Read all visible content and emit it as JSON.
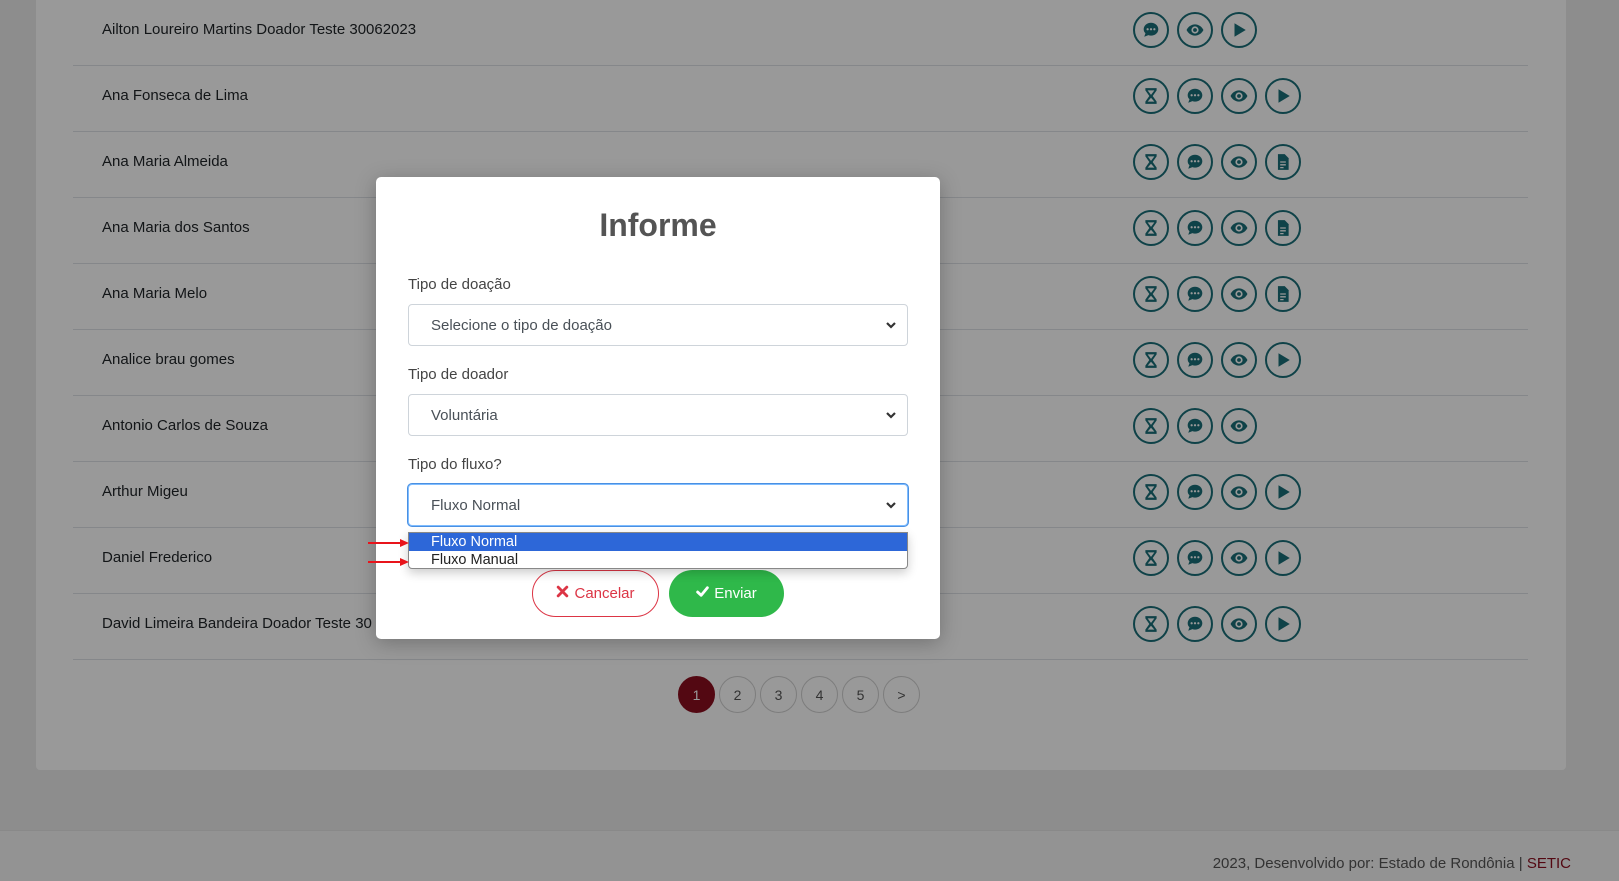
{
  "list": {
    "rows": [
      {
        "name": "Ailton Loureiro Martins Doador Teste 30062023",
        "actions": [
          "chat-icon",
          "eye-icon",
          "play-icon"
        ]
      },
      {
        "name": "Ana Fonseca de Lima",
        "actions": [
          "hourglass-icon",
          "chat-icon",
          "eye-icon",
          "play-icon"
        ]
      },
      {
        "name": "Ana Maria Almeida",
        "actions": [
          "hourglass-icon",
          "chat-icon",
          "eye-icon",
          "document-icon"
        ]
      },
      {
        "name": "Ana Maria dos Santos",
        "actions": [
          "hourglass-icon",
          "chat-icon",
          "eye-icon",
          "document-icon"
        ]
      },
      {
        "name": "Ana Maria Melo",
        "actions": [
          "hourglass-icon",
          "chat-icon",
          "eye-icon",
          "document-icon"
        ]
      },
      {
        "name": "Analice brau gomes",
        "actions": [
          "hourglass-icon",
          "chat-icon",
          "eye-icon",
          "play-icon"
        ]
      },
      {
        "name": "Antonio Carlos de Souza",
        "actions": [
          "hourglass-icon",
          "chat-icon",
          "eye-icon"
        ]
      },
      {
        "name": "Arthur Migeu",
        "actions": [
          "hourglass-icon",
          "chat-icon",
          "eye-icon",
          "play-icon"
        ]
      },
      {
        "name": "Daniel Frederico",
        "actions": [
          "hourglass-icon",
          "chat-icon",
          "eye-icon",
          "play-icon"
        ]
      },
      {
        "name": "David Limeira Bandeira Doador Teste 30",
        "actions": [
          "hourglass-icon",
          "chat-icon",
          "eye-icon",
          "play-icon"
        ]
      }
    ]
  },
  "pagination": {
    "pages": [
      "1",
      "2",
      "3",
      "4",
      "5"
    ],
    "active": "1",
    "next": ">"
  },
  "footer": {
    "text": "2023, Desenvolvido por: Estado de Rondônia | ",
    "brand": "SETIC"
  },
  "modal": {
    "title": "Informe",
    "donation_type": {
      "label": "Tipo de doação",
      "value": "Selecione o tipo de doação"
    },
    "donor_type": {
      "label": "Tipo de doador",
      "value": "Voluntária"
    },
    "flow_type": {
      "label": "Tipo do fluxo?",
      "value": "Fluxo Normal",
      "options": [
        "Fluxo Normal",
        "Fluxo Manual"
      ]
    },
    "cancel_label": "Cancelar",
    "send_label": "Enviar"
  },
  "colors": {
    "accent_teal": "#1a6f78",
    "active_page": "#8b0e1e",
    "send_green": "#2fb84a",
    "cancel_red": "#dc3545",
    "option_highlight": "#2d67d8",
    "annotation_arrow": "#e8141b"
  }
}
